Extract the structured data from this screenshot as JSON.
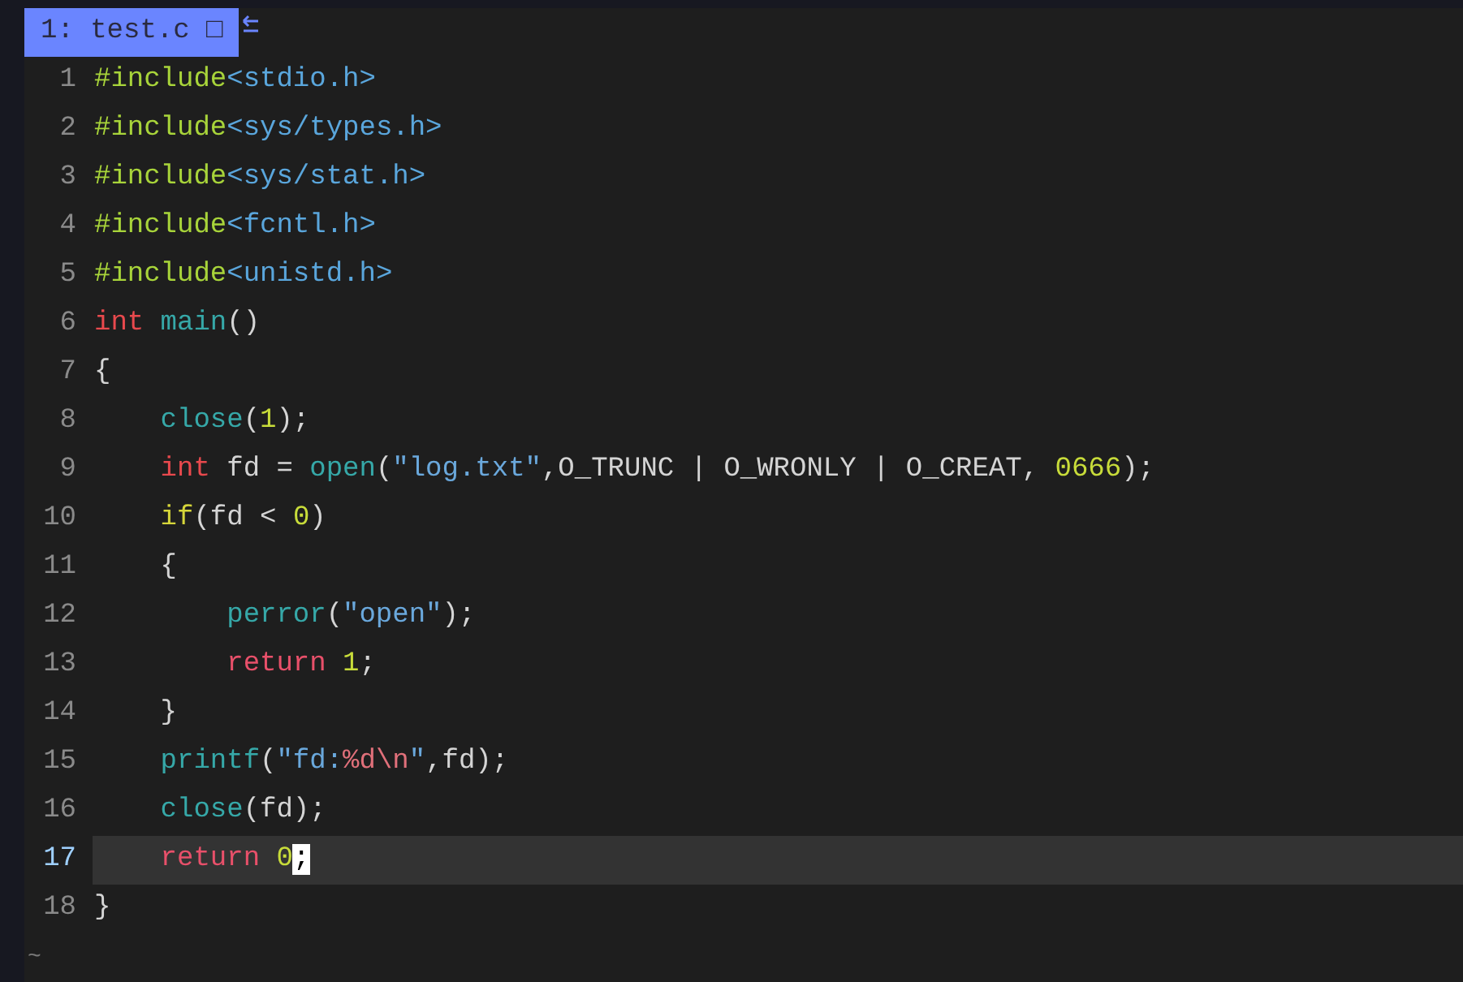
{
  "tabline": {
    "tabs": [
      {
        "label": "1: test.c □",
        "selected": true
      }
    ]
  },
  "lines": [
    {
      "number": "1",
      "current": false,
      "tokens": [
        {
          "kind": "preproc",
          "text": "#include"
        },
        {
          "kind": "header",
          "text": "<stdio.h>"
        }
      ]
    },
    {
      "number": "2",
      "current": false,
      "tokens": [
        {
          "kind": "preproc",
          "text": "#include"
        },
        {
          "kind": "header",
          "text": "<sys/types.h>"
        }
      ]
    },
    {
      "number": "3",
      "current": false,
      "tokens": [
        {
          "kind": "preproc",
          "text": "#include"
        },
        {
          "kind": "header",
          "text": "<sys/stat.h>"
        }
      ]
    },
    {
      "number": "4",
      "current": false,
      "tokens": [
        {
          "kind": "preproc",
          "text": "#include"
        },
        {
          "kind": "header",
          "text": "<fcntl.h>"
        }
      ]
    },
    {
      "number": "5",
      "current": false,
      "tokens": [
        {
          "kind": "preproc",
          "text": "#include"
        },
        {
          "kind": "header",
          "text": "<unistd.h>"
        }
      ]
    },
    {
      "number": "6",
      "current": false,
      "tokens": [
        {
          "kind": "type",
          "text": "int"
        },
        {
          "kind": "func",
          "text": " main"
        },
        {
          "kind": "plain",
          "text": "()"
        }
      ]
    },
    {
      "number": "7",
      "current": false,
      "tokens": [
        {
          "kind": "plain",
          "text": "{"
        }
      ]
    },
    {
      "number": "8",
      "current": false,
      "tokens": [
        {
          "kind": "func",
          "text": "    close"
        },
        {
          "kind": "plain",
          "text": "("
        },
        {
          "kind": "number",
          "text": "1"
        },
        {
          "kind": "plain",
          "text": ");"
        }
      ]
    },
    {
      "number": "9",
      "current": false,
      "tokens": [
        {
          "kind": "type",
          "text": "    int"
        },
        {
          "kind": "plain",
          "text": " fd = "
        },
        {
          "kind": "func",
          "text": "open"
        },
        {
          "kind": "plain",
          "text": "("
        },
        {
          "kind": "string",
          "text": "\"log.txt\""
        },
        {
          "kind": "plain",
          "text": ",O_TRUNC | O_WRONLY | O_CREAT, "
        },
        {
          "kind": "number",
          "text": "0666"
        },
        {
          "kind": "plain",
          "text": ");"
        }
      ]
    },
    {
      "number": "10",
      "current": false,
      "tokens": [
        {
          "kind": "cond",
          "text": "    if"
        },
        {
          "kind": "plain",
          "text": "(fd < "
        },
        {
          "kind": "number",
          "text": "0"
        },
        {
          "kind": "plain",
          "text": ")"
        }
      ]
    },
    {
      "number": "11",
      "current": false,
      "tokens": [
        {
          "kind": "plain",
          "text": "    {"
        }
      ]
    },
    {
      "number": "12",
      "current": false,
      "tokens": [
        {
          "kind": "func",
          "text": "        perror"
        },
        {
          "kind": "plain",
          "text": "("
        },
        {
          "kind": "string",
          "text": "\"open\""
        },
        {
          "kind": "plain",
          "text": ");"
        }
      ]
    },
    {
      "number": "13",
      "current": false,
      "tokens": [
        {
          "kind": "keyword",
          "text": "        return"
        },
        {
          "kind": "number",
          "text": " 1"
        },
        {
          "kind": "plain",
          "text": ";"
        }
      ]
    },
    {
      "number": "14",
      "current": false,
      "tokens": [
        {
          "kind": "plain",
          "text": "    }"
        }
      ]
    },
    {
      "number": "15",
      "current": false,
      "tokens": [
        {
          "kind": "func",
          "text": "    printf"
        },
        {
          "kind": "plain",
          "text": "("
        },
        {
          "kind": "string",
          "text": "\"fd:"
        },
        {
          "kind": "format",
          "text": "%d\\n"
        },
        {
          "kind": "string",
          "text": "\""
        },
        {
          "kind": "plain",
          "text": ",fd);"
        }
      ]
    },
    {
      "number": "16",
      "current": false,
      "tokens": [
        {
          "kind": "func",
          "text": "    close"
        },
        {
          "kind": "plain",
          "text": "(fd);"
        }
      ]
    },
    {
      "number": "17",
      "current": true,
      "tokens": [
        {
          "kind": "keyword",
          "text": "    return"
        },
        {
          "kind": "number",
          "text": " 0"
        },
        {
          "kind": "cursor",
          "text": ";"
        }
      ]
    },
    {
      "number": "18",
      "current": false,
      "tokens": [
        {
          "kind": "plain",
          "text": "}"
        }
      ]
    }
  ],
  "filler_lines": [
    "~"
  ]
}
